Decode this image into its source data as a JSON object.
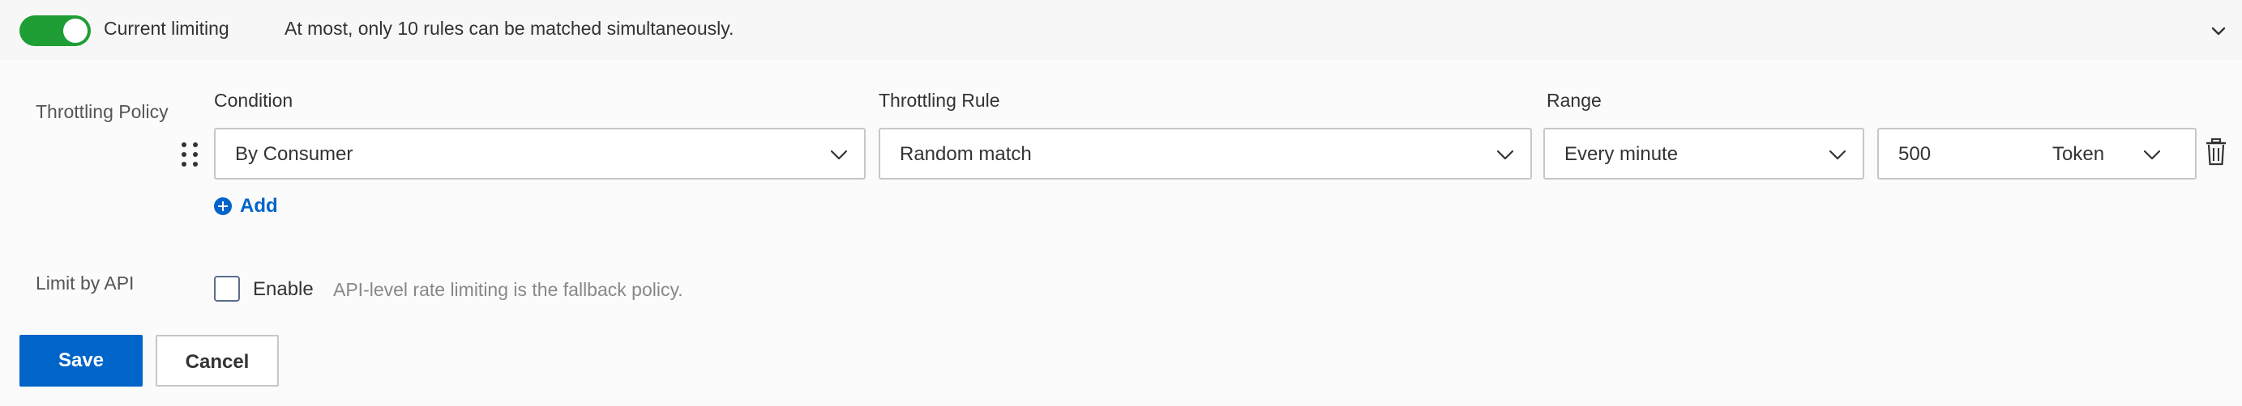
{
  "header": {
    "toggle_on": true,
    "title": "Current limiting",
    "note": "At most, only 10 rules can be matched simultaneously."
  },
  "throttling_policy": {
    "label": "Throttling Policy",
    "columns": {
      "condition": "Condition",
      "rule": "Throttling Rule",
      "range": "Range"
    },
    "row": {
      "condition": "By Consumer",
      "rule": "Random match",
      "range": "Every minute",
      "limit_value": "500",
      "limit_unit": "Token"
    },
    "add_label": "Add"
  },
  "limit_by_api": {
    "label": "Limit by API",
    "checkbox_label": "Enable",
    "checked": false,
    "hint": "API-level rate limiting is the fallback policy."
  },
  "actions": {
    "save_label": "Save",
    "cancel_label": "Cancel"
  },
  "colors": {
    "toggle_on": "#1e9e35",
    "primary": "#0064c8",
    "border": "#c7c7c7"
  }
}
